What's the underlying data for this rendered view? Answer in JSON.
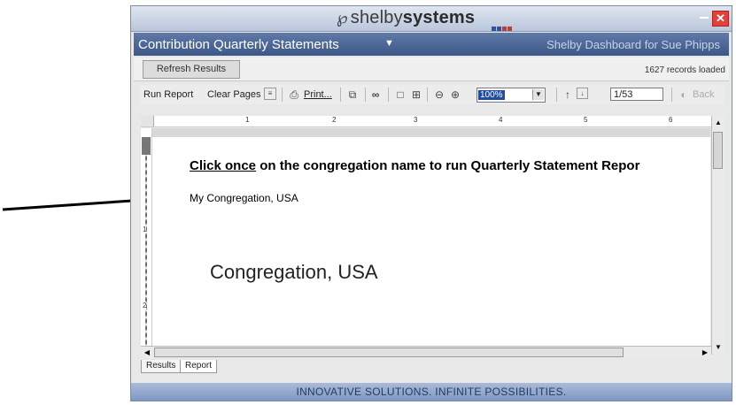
{
  "brand": {
    "name_light": "shelby",
    "name_bold": "systems"
  },
  "window": {
    "title": "Contribution Quarterly Statements",
    "dashboard_label": "Shelby Dashboard for Sue Phipps"
  },
  "results_bar": {
    "refresh_label": "Refresh Results",
    "records_loaded": "1627 records loaded"
  },
  "toolbar": {
    "run_report": "Run Report",
    "clear_pages": "Clear Pages",
    "print": "Print...",
    "zoom_value": "100%",
    "page_value": "1/53",
    "back": "Back"
  },
  "ruler": {
    "numbers": [
      "1",
      "2",
      "3",
      "4",
      "5",
      "6"
    ]
  },
  "vruler": {
    "numbers": [
      "1",
      "2"
    ]
  },
  "report": {
    "heading_click": "Click once",
    "heading_rest": " on the congregation name to run Quarterly Statement Repor",
    "congregation_link": "My Congregation, USA"
  },
  "annotation": {
    "callout": "Congregation, USA"
  },
  "tabs": {
    "results": "Results",
    "report": "Report"
  },
  "footer": {
    "tagline": "INNOVATIVE SOLUTIONS. INFINITE POSSIBILITIES."
  },
  "colors": {
    "title_bar": "#4a64939",
    "footer_bar": "#8da4cc",
    "close_button": "#e2413a"
  }
}
